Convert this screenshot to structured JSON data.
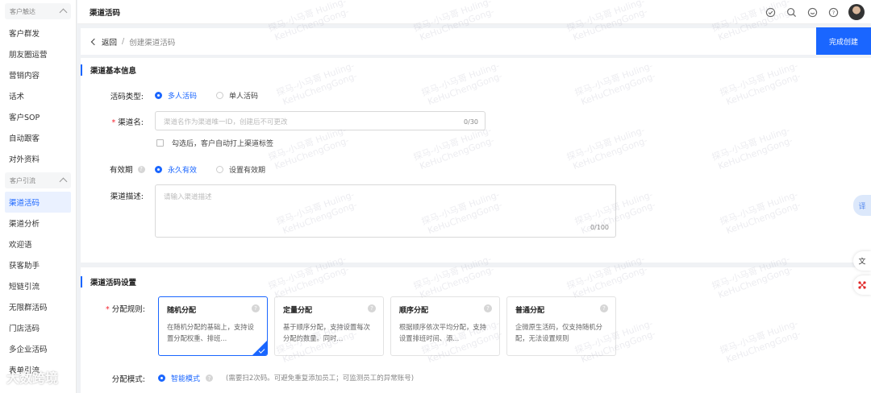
{
  "sidebar": {
    "group1_label": "客户触达",
    "group1_items": [
      "客户群发",
      "朋友圈运营",
      "营销内容",
      "话术",
      "客户SOP",
      "自动跟客",
      "对外资料"
    ],
    "group2_label": "客户引流",
    "group2_items": [
      "渠道活码",
      "渠道分析",
      "欢迎语",
      "获客助手",
      "短链引流",
      "无限群活码",
      "门店活码",
      "多企业活码",
      "表单引流"
    ],
    "active_item": "渠道活码"
  },
  "topbar": {
    "title": "渠道活码",
    "icons": [
      "check-circle-icon",
      "search-icon",
      "message-icon",
      "help-circle-icon"
    ]
  },
  "breadcrumb": {
    "back_label": "返回",
    "separator": "/",
    "current": "创建渠道活码"
  },
  "actions": {
    "complete_label": "完成创建"
  },
  "basic_info": {
    "section_title": "渠道基本信息",
    "code_type_label": "活码类型:",
    "code_type_options": [
      "多人活码",
      "单人活码"
    ],
    "code_type_selected": "多人活码",
    "channel_name_label": "渠道名:",
    "channel_name_placeholder": "渠道名作为渠道唯一ID，创建后不可更改",
    "channel_name_count": "0/30",
    "auto_tag_label": "勾选后，客户自动打上渠道标签",
    "validity_label": "有效期",
    "validity_options": [
      "永久有效",
      "设置有效期"
    ],
    "validity_selected": "永久有效",
    "description_label": "渠道描述:",
    "description_placeholder": "请输入渠道描述",
    "description_count": "0/100"
  },
  "code_settings": {
    "section_title": "渠道活码设置",
    "rule_label": "分配规则:",
    "rules": [
      {
        "title": "随机分配",
        "desc": "在随机分配的基础上，支持设置分配权重、排班..."
      },
      {
        "title": "定量分配",
        "desc": "基于顺序分配，支持设置每次分配的数量。同时..."
      },
      {
        "title": "顺序分配",
        "desc": "根据顺序依次平均分配，支持设置排班时间、添..."
      },
      {
        "title": "普通分配",
        "desc": "企微原生活码，仅支持随机分配，无法设置规则"
      }
    ],
    "rule_selected": "随机分配",
    "mode_label": "分配模式:",
    "mode_option": "智能模式",
    "mode_hint": "(需要扫2次码。可避免重复添加员工；可监测员工的异常账号)"
  },
  "side_widgets": {
    "translate_label": "译"
  },
  "watermark": {
    "line1": "探马-小马哥 Huling-",
    "line2": "KeHuChengGong-",
    "brand": "大数跨境"
  },
  "colors": {
    "primary": "#1a66ff",
    "required": "#f5222d"
  }
}
